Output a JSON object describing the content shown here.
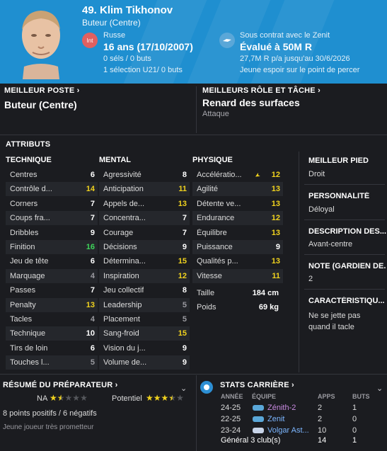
{
  "header": {
    "title": "49. Klim Tikhonov",
    "subtitle": "Buteur (Centre)",
    "flag_text": "Int",
    "nationality": "Russe",
    "age": "16 ans (17/10/2007)",
    "caps": "0 séls / 0 buts",
    "u21": "1 sélection U21/ 0 buts",
    "contract": "Sous contrat avec le Zenit",
    "value": "Évalué à 50M R",
    "wage": "27,7M R p/a jusqu'au 30/6/2026",
    "status": "Jeune espoir sur le point de percer",
    "bg": "#1f8fd0"
  },
  "best_position": {
    "label": "MEILLEUR POSTE",
    "value": "Buteur (Centre)"
  },
  "best_role": {
    "label": "MEILLEURS RÔLE ET TÂCHE",
    "value": "Renard des surfaces",
    "duty": "Attaque"
  },
  "attributes": {
    "title": "ATTRIBUTS",
    "technical": {
      "title": "TECHNIQUE",
      "items": [
        {
          "name": "Centres",
          "value": "6"
        },
        {
          "name": "Contrôle d...",
          "value": "14"
        },
        {
          "name": "Corners",
          "value": "7"
        },
        {
          "name": "Coups fra...",
          "value": "7"
        },
        {
          "name": "Dribbles",
          "value": "9"
        },
        {
          "name": "Finition",
          "value": "16"
        },
        {
          "name": "Jeu de tête",
          "value": "6"
        },
        {
          "name": "Marquage",
          "value": "4"
        },
        {
          "name": "Passes",
          "value": "7"
        },
        {
          "name": "Penalty",
          "value": "13"
        },
        {
          "name": "Tacles",
          "value": "4"
        },
        {
          "name": "Technique",
          "value": "10"
        },
        {
          "name": "Tirs de loin",
          "value": "6"
        },
        {
          "name": "Touches l...",
          "value": "5"
        }
      ]
    },
    "mental": {
      "title": "MENTAL",
      "items": [
        {
          "name": "Agressivité",
          "value": "8"
        },
        {
          "name": "Anticipation",
          "value": "11"
        },
        {
          "name": "Appels de...",
          "value": "13"
        },
        {
          "name": "Concentra...",
          "value": "7"
        },
        {
          "name": "Courage",
          "value": "7"
        },
        {
          "name": "Décisions",
          "value": "9"
        },
        {
          "name": "Détermina...",
          "value": "15"
        },
        {
          "name": "Inspiration",
          "value": "12"
        },
        {
          "name": "Jeu collectif",
          "value": "8"
        },
        {
          "name": "Leadership",
          "value": "5"
        },
        {
          "name": "Placement",
          "value": "5"
        },
        {
          "name": "Sang-froid",
          "value": "15"
        },
        {
          "name": "Vision du j...",
          "value": "9"
        },
        {
          "name": "Volume de...",
          "value": "9"
        }
      ]
    },
    "physical": {
      "title": "PHYSIQUE",
      "items": [
        {
          "name": "Accélératio...",
          "value": "12"
        },
        {
          "name": "Agilité",
          "value": "13"
        },
        {
          "name": "Détente ve...",
          "value": "13"
        },
        {
          "name": "Endurance",
          "value": "12"
        },
        {
          "name": "Équilibre",
          "value": "13"
        },
        {
          "name": "Puissance",
          "value": "9"
        },
        {
          "name": "Qualités p...",
          "value": "13"
        },
        {
          "name": "Vitesse",
          "value": "11"
        }
      ],
      "height_label": "Taille",
      "height": "184 cm",
      "weight_label": "Poids",
      "weight": "69 kg"
    }
  },
  "side": {
    "foot_label": "MEILLEUR PIED",
    "foot": "Droit",
    "personality_label": "PERSONNALITÉ",
    "personality": "Déloyal",
    "description_label": "DESCRIPTION DES...",
    "description": "Avant-centre",
    "gk_label": "NOTE (GARDIEN DE...",
    "gk": "2",
    "traits_label": "CARACTÉRISTIQU...",
    "traits_1": "Ne se jette pas",
    "traits_2": "quand il tacle"
  },
  "coach": {
    "title": "RÉSUMÉ DU PRÉPARATEUR",
    "na_label": "NA",
    "na_stars": 1.5,
    "potential_label": "Potentiel",
    "potential_stars": 3.5,
    "summary": "8 points positifs / 6 négatifs",
    "note": "Jeune joueur très prometteur"
  },
  "career": {
    "title": "STATS CARRIÈRE",
    "headers": {
      "year": "ANNÉE",
      "team": "ÉQUIPE",
      "apps": "APPS",
      "goals": "BUTS"
    },
    "rows": [
      {
        "year": "24-25",
        "team": "Zénith-2",
        "apps": "2",
        "goals": "1"
      },
      {
        "year": "22-25",
        "team": "Zenit",
        "apps": "2",
        "goals": "0"
      },
      {
        "year": "23-24",
        "team": "Volgar Ast...",
        "apps": "10",
        "goals": "0"
      }
    ],
    "total_label": "Général 3 club(s)",
    "total_apps": "14",
    "total_goals": "1"
  },
  "colors": {
    "high": "#f0d21e",
    "top": "#3ed45a",
    "mid": "#ffffff",
    "low": "#9a9aa0"
  }
}
